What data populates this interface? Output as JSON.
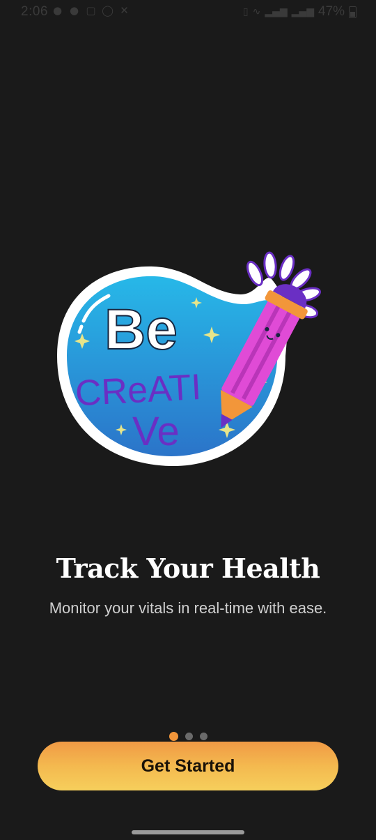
{
  "status_bar": {
    "time": "2:06",
    "battery": "47%",
    "left_icons": [
      "ghost-icon",
      "ghost-icon",
      "instagram-icon",
      "whatsapp-icon",
      "missed-call-icon"
    ],
    "right_icons": [
      "vibrate-icon",
      "wifi-calling-icon",
      "signal-icon",
      "signal-icon"
    ]
  },
  "illustration": {
    "line1": "Be",
    "line2": "CReATI",
    "line3": "Ve"
  },
  "onboarding": {
    "title": "Track Your Health",
    "subtitle": "Monitor your vitals in real-time with ease.",
    "page_index": 1,
    "page_count": 3
  },
  "cta": {
    "label": "Get Started"
  },
  "colors": {
    "background": "#1a1a1a",
    "accent": "#f2963a",
    "button_gradient_start": "#f09a45",
    "button_gradient_end": "#f6cf5c",
    "inactive_dot": "#6a6a6a"
  }
}
